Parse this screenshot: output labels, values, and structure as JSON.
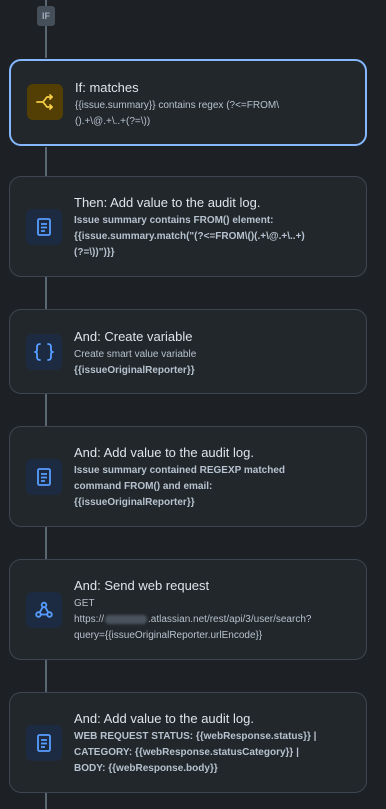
{
  "flow": {
    "if_badge": "IF",
    "cards": [
      {
        "title": "If: matches",
        "lines": [
          "{{issue.summary}} contains regex (?<=FROM\\",
          "().+\\@.+\\..+(?=\\))"
        ],
        "icon": "branch-icon"
      },
      {
        "title": "Then: Add value to the audit log.",
        "lines": [
          "Issue summary contains FROM() element:",
          "{{issue.summary.match(\"(?<=FROM\\()(.+\\@.+\\..+)",
          "(?=\\))\")}}"
        ],
        "icon": "document-icon"
      },
      {
        "title": "And: Create variable",
        "lines": [
          "Create smart value variable",
          "{{issueOriginalReporter}}"
        ],
        "icon": "curly-braces-icon"
      },
      {
        "title": "And: Add value to the audit log.",
        "lines": [
          "Issue summary contained REGEXP matched",
          "command FROM() and email:",
          "{{issueOriginalReporter}}"
        ],
        "icon": "document-icon"
      },
      {
        "title": "And: Send web request",
        "method": "GET",
        "url_prefix": "https://",
        "url_suffix": ".atlassian.net/rest/api/3/user/search?",
        "url_line2": "query={{issueOriginalReporter.urlEncode}}",
        "icon": "webhook-icon"
      },
      {
        "title": "And: Add value to the audit log.",
        "lines": [
          "WEB REQUEST STATUS: {{webResponse.status}} |",
          "CATEGORY: {{webResponse.statusCategory}} |",
          "BODY: {{webResponse.body}}"
        ],
        "icon": "document-icon"
      }
    ]
  },
  "colors": {
    "background": "#1d2125",
    "card": "#22272b",
    "selected_border": "#85b8ff",
    "branch_accent": "#f5cd47",
    "action_accent": "#579dff"
  }
}
